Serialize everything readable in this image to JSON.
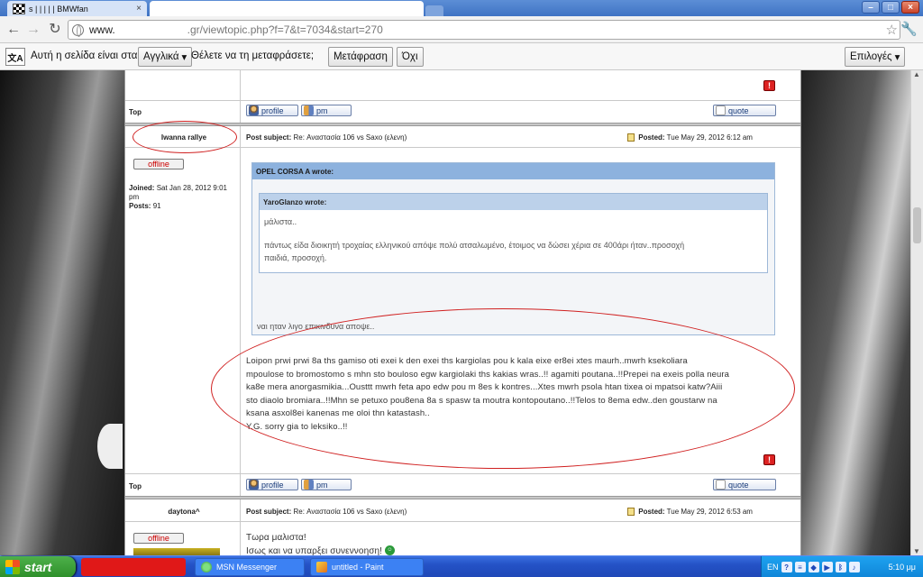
{
  "browser": {
    "tabs": [
      {
        "title": "s | | | | | BMWfan"
      },
      {
        "title": ""
      }
    ],
    "url_prefix": "www.",
    "url_path": ".gr/viewtopic.php?f=7&t=7034&start=270"
  },
  "translate_bar": {
    "prompt": "Αυτή η σελίδα είναι στα",
    "language": "Αγγλικά",
    "question": "Θέλετε να τη μεταφράσετε;",
    "translate_button": "Μετάφραση",
    "no_button": "Όχι",
    "options_button": "Επιλογές",
    "icon_glyph": "文A"
  },
  "forum": {
    "top_label": "Top",
    "profile_label": "profile",
    "pm_label": "pm",
    "quote_label": "quote",
    "posts": [
      {
        "author": "Iwanna rallye",
        "status": "offline",
        "joined_label": "Joined:",
        "joined_value": "Sat Jan 28, 2012 9:01 pm",
        "posts_label": "Posts:",
        "posts_value": "91",
        "subject_label": "Post subject:",
        "subject": "Re: Αναστασία 106 vs Saxo (ελενη)",
        "posted_label": "Posted:",
        "posted": "Tue May 29, 2012 6:12 am",
        "outer_quote_author": "OPEL CORSA A wrote:",
        "inner_quote_author": "YaroGlanzo wrote:",
        "inner_quote_line1": "μάλιστα..",
        "inner_quote_line2": "πάντως είδα διοικητή τροχαίας ελληνικού απόψε πολύ ατσαλωμένο, έτοιμος να δώσει χέρια σε 400άρι ήταν..προσοχή",
        "inner_quote_line3": "παιδιά, προσοχή.",
        "outer_quote_text": "ναι ηταν λιγο επικινδυνα αποψε..",
        "body_lines": [
          "Loipon prwi prwi 8a ths gamiso oti exei k den exei ths kargiolas pou k kala eixe er8ei xtes maurh..mwrh ksekoliara",
          "mpoulose to bromostomo s mhn sto bouloso egw kargiolaki ths kakias wras..!! agamiti poutana..!!Prepei na exeis polla neura",
          "ka8e mera anorgasmikia...Ousttt mwrh feta apo edw pou m 8es k kontres...Xtes mwrh psola htan tixea oi mpatsoi katw?Aiii",
          "sto diaolo bromiara..!!Mhn se petuxo pou8ena 8a s spasw ta moutra kontopoutano..!!Telos to 8ema edw..den goustarw na",
          "ksana asxol8ei kanenas me oloi thn katastash..",
          "Y.G. sorry gia to leksiko..!!"
        ]
      },
      {
        "author": "daytona^",
        "status": "offline",
        "subject_label": "Post subject:",
        "subject": "Re: Αναστασία 106 vs Saxo (ελενη)",
        "posted_label": "Posted:",
        "posted": "Tue May 29, 2012 6:53 am",
        "body_line1": "Τωρα μαλιστα!",
        "body_line2": "Ισως και να υπαρξει συνεννοηση!"
      }
    ]
  },
  "taskbar": {
    "start_label": "start",
    "tasks": [
      {
        "label": "MSN Messenger"
      },
      {
        "label": "untitled - Paint"
      }
    ],
    "language": "EN",
    "clock": "5:10 μμ"
  }
}
